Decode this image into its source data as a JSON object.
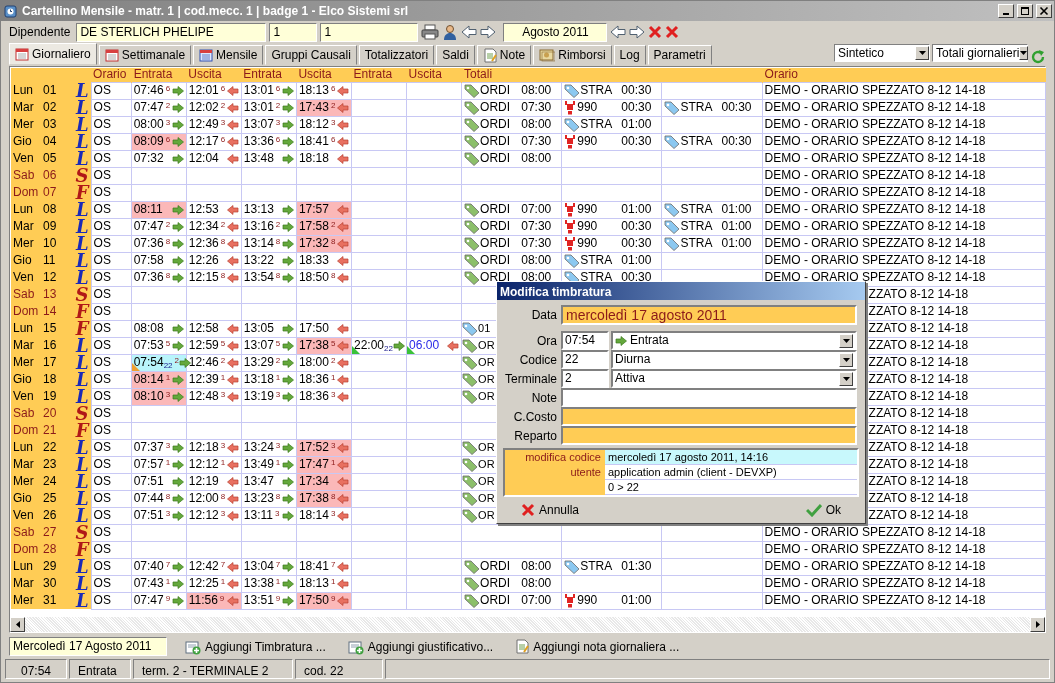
{
  "window": {
    "title": "Cartellino Mensile - matr. 1 | cod.mecc. 1 | badge 1 - Elco Sistemi srl"
  },
  "toolbar": {
    "employee_label": "Dipendente",
    "employee": "DE STERLICH PHELIPE",
    "field_2": "1",
    "field_3": "1",
    "month": "Agosto 2011"
  },
  "tabs": [
    {
      "label": "Giornaliero",
      "selected": true
    },
    {
      "label": "Settimanale",
      "selected": false
    },
    {
      "label": "Mensile",
      "selected": false
    },
    {
      "label": "Gruppi Causali",
      "selected": false
    },
    {
      "label": "Totalizzatori",
      "selected": false
    },
    {
      "label": "Saldi",
      "selected": false
    },
    {
      "label": "Note",
      "selected": false
    },
    {
      "label": "Rimborsi",
      "selected": false
    },
    {
      "label": "Log",
      "selected": false
    },
    {
      "label": "Parametri",
      "selected": false
    }
  ],
  "view_select": "Sintetico",
  "totals_select": "Totali giornalieri",
  "table": {
    "columns": [
      "Orario",
      "Entrata",
      "Uscita",
      "Entrata",
      "Uscita",
      "Entrata",
      "Uscita",
      "Totali",
      "Orario"
    ],
    "days": [
      {
        "day": "Lun",
        "num": "01",
        "letter": "L",
        "rest": false,
        "weekend": false,
        "shift": "OS",
        "punches": [
          {
            "time": "07:46",
            "sup": "6",
            "late": false
          },
          {
            "time": "12:01",
            "sup": "6",
            "late": false
          },
          {
            "time": "13:01",
            "sup": "6",
            "late": false
          },
          {
            "time": "18:13",
            "sup": "6",
            "late": false
          }
        ],
        "totals": [
          {
            "kind": "green",
            "code": "ORDI",
            "time": "08:00"
          },
          {
            "kind": "blue",
            "code": "STRA",
            "time": "00:30"
          }
        ],
        "schedule": "DEMO - ORARIO SPEZZATO 8-12 14-18",
        "behind_dialog": false
      },
      {
        "day": "Mar",
        "num": "02",
        "letter": "L",
        "rest": false,
        "weekend": false,
        "shift": "OS",
        "punches": [
          {
            "time": "07:47",
            "sup": "2",
            "late": false
          },
          {
            "time": "12:02",
            "sup": "2",
            "late": false
          },
          {
            "time": "13:01",
            "sup": "2",
            "late": false
          },
          {
            "time": "17:43",
            "sup": "2",
            "late": true
          }
        ],
        "totals": [
          {
            "kind": "green",
            "code": "ORDI",
            "time": "07:30"
          },
          {
            "kind": "alert",
            "code": "990",
            "time": "00:30"
          },
          {
            "kind": "blue",
            "code": "STRA",
            "time": "00:30"
          }
        ],
        "schedule": "DEMO - ORARIO SPEZZATO 8-12 14-18",
        "behind_dialog": false
      },
      {
        "day": "Mer",
        "num": "03",
        "letter": "L",
        "rest": false,
        "weekend": false,
        "shift": "OS",
        "punches": [
          {
            "time": "08:00",
            "sup": "3",
            "late": false
          },
          {
            "time": "12:49",
            "sup": "3",
            "late": false
          },
          {
            "time": "13:07",
            "sup": "3",
            "late": false
          },
          {
            "time": "18:12",
            "sup": "3",
            "late": false
          }
        ],
        "totals": [
          {
            "kind": "green",
            "code": "ORDI",
            "time": "08:00"
          },
          {
            "kind": "blue",
            "code": "STRA",
            "time": "01:00"
          }
        ],
        "schedule": "DEMO - ORARIO SPEZZATO 8-12 14-18",
        "behind_dialog": false
      },
      {
        "day": "Gio",
        "num": "04",
        "letter": "L",
        "rest": false,
        "weekend": false,
        "shift": "OS",
        "punches": [
          {
            "time": "08:09",
            "sup": "6",
            "late": true
          },
          {
            "time": "12:17",
            "sup": "6",
            "late": false
          },
          {
            "time": "13:36",
            "sup": "6",
            "late": false
          },
          {
            "time": "18:41",
            "sup": "6",
            "late": false
          }
        ],
        "totals": [
          {
            "kind": "green",
            "code": "ORDI",
            "time": "07:30"
          },
          {
            "kind": "alert",
            "code": "990",
            "time": "00:30"
          },
          {
            "kind": "blue",
            "code": "STRA",
            "time": "00:30"
          }
        ],
        "schedule": "DEMO - ORARIO SPEZZATO 8-12 14-18",
        "behind_dialog": false
      },
      {
        "day": "Ven",
        "num": "05",
        "letter": "L",
        "rest": false,
        "weekend": false,
        "shift": "OS",
        "punches": [
          {
            "time": "07:32",
            "late": false
          },
          {
            "time": "12:04",
            "late": false
          },
          {
            "time": "13:48",
            "late": false
          },
          {
            "time": "18:18",
            "late": false
          }
        ],
        "totals": [
          {
            "kind": "green",
            "code": "ORDI",
            "time": "08:00"
          }
        ],
        "schedule": "DEMO - ORARIO SPEZZATO 8-12 14-18",
        "behind_dialog": false
      },
      {
        "day": "Sab",
        "num": "06",
        "letter": "S",
        "rest": true,
        "weekend": true,
        "shift": "OS",
        "schedule": "DEMO - ORARIO SPEZZATO 8-12 14-18",
        "behind_dialog": false
      },
      {
        "day": "Dom",
        "num": "07",
        "letter": "F",
        "rest": true,
        "weekend": true,
        "shift": "OS",
        "schedule": "DEMO - ORARIO SPEZZATO 8-12 14-18",
        "behind_dialog": false
      },
      {
        "day": "Lun",
        "num": "08",
        "letter": "L",
        "rest": false,
        "weekend": false,
        "shift": "OS",
        "punches": [
          {
            "time": "08:11",
            "late": true
          },
          {
            "time": "12:53",
            "late": false
          },
          {
            "time": "13:13",
            "late": false
          },
          {
            "time": "17:57",
            "late": true
          }
        ],
        "totals": [
          {
            "kind": "green",
            "code": "ORDI",
            "time": "07:00"
          },
          {
            "kind": "alert",
            "code": "990",
            "time": "01:00"
          },
          {
            "kind": "blue",
            "code": "STRA",
            "time": "01:00"
          }
        ],
        "schedule": "DEMO - ORARIO SPEZZATO 8-12 14-18",
        "behind_dialog": false
      },
      {
        "day": "Mar",
        "num": "09",
        "letter": "L",
        "rest": false,
        "weekend": false,
        "shift": "OS",
        "punches": [
          {
            "time": "07:47",
            "sup": "2",
            "late": false
          },
          {
            "time": "12:34",
            "sup": "2",
            "late": false
          },
          {
            "time": "13:16",
            "sup": "2",
            "late": false
          },
          {
            "time": "17:58",
            "sup": "2",
            "late": true
          }
        ],
        "totals": [
          {
            "kind": "green",
            "code": "ORDI",
            "time": "07:30"
          },
          {
            "kind": "alert",
            "code": "990",
            "time": "00:30"
          },
          {
            "kind": "blue",
            "code": "STRA",
            "time": "01:00"
          }
        ],
        "schedule": "DEMO - ORARIO SPEZZATO 8-12 14-18",
        "behind_dialog": false
      },
      {
        "day": "Mer",
        "num": "10",
        "letter": "L",
        "rest": false,
        "weekend": false,
        "shift": "OS",
        "punches": [
          {
            "time": "07:36",
            "sup": "8",
            "late": false
          },
          {
            "time": "12:36",
            "sup": "8",
            "late": false
          },
          {
            "time": "13:14",
            "sup": "8",
            "late": false
          },
          {
            "time": "17:32",
            "sup": "8",
            "late": true
          }
        ],
        "totals": [
          {
            "kind": "green",
            "code": "ORDI",
            "time": "07:30"
          },
          {
            "kind": "alert",
            "code": "990",
            "time": "00:30"
          },
          {
            "kind": "blue",
            "code": "STRA",
            "time": "01:00"
          }
        ],
        "schedule": "DEMO - ORARIO SPEZZATO 8-12 14-18",
        "behind_dialog": false
      },
      {
        "day": "Gio",
        "num": "11",
        "letter": "L",
        "rest": false,
        "weekend": false,
        "shift": "OS",
        "punches": [
          {
            "time": "07:58",
            "late": false
          },
          {
            "time": "12:26",
            "late": false
          },
          {
            "time": "13:22",
            "late": false
          },
          {
            "time": "18:33",
            "late": false
          }
        ],
        "totals": [
          {
            "kind": "green",
            "code": "ORDI",
            "time": "08:00"
          },
          {
            "kind": "blue",
            "code": "STRA",
            "time": "01:00"
          }
        ],
        "schedule": "DEMO - ORARIO SPEZZATO 8-12 14-18",
        "behind_dialog": false
      },
      {
        "day": "Ven",
        "num": "12",
        "letter": "L",
        "rest": false,
        "weekend": false,
        "shift": "OS",
        "punches": [
          {
            "time": "07:36",
            "sup": "8",
            "late": false
          },
          {
            "time": "12:15",
            "sup": "8",
            "late": false
          },
          {
            "time": "13:54",
            "sup": "8",
            "late": false
          },
          {
            "time": "18:50",
            "sup": "8",
            "late": false
          }
        ],
        "totals": [
          {
            "kind": "green",
            "code": "ORDI",
            "time": "08:00"
          },
          {
            "kind": "blue",
            "code": "STRA",
            "time": "00:30"
          }
        ],
        "schedule": "DEMO - ORARIO SPEZZATO 8-12 14-18",
        "behind_dialog": false
      },
      {
        "day": "Sab",
        "num": "13",
        "letter": "S",
        "rest": true,
        "weekend": true,
        "shift": "OS",
        "schedule": "ZZATO 8-12 14-18",
        "behind_dialog": true
      },
      {
        "day": "Dom",
        "num": "14",
        "letter": "F",
        "rest": true,
        "weekend": true,
        "shift": "OS",
        "schedule": "ZZATO 8-12 14-18",
        "behind_dialog": true
      },
      {
        "day": "Lun",
        "num": "15",
        "letter": "F",
        "rest": true,
        "weekend": false,
        "shift": "OS",
        "punches": [
          {
            "time": "08:08",
            "late": false
          },
          {
            "time": "12:58",
            "late": false
          },
          {
            "time": "13:05",
            "late": false
          },
          {
            "time": "17:50",
            "late": false
          }
        ],
        "totals": [
          {
            "kind": "blue",
            "code": "01"
          }
        ],
        "schedule": "ZZATO 8-12 14-18",
        "behind_dialog": true
      },
      {
        "day": "Mar",
        "num": "16",
        "letter": "L",
        "rest": false,
        "weekend": false,
        "shift": "OS",
        "punches": [
          {
            "time": "07:53",
            "sup": "5",
            "late": false
          },
          {
            "time": "12:59",
            "sup": "5",
            "late": false
          },
          {
            "time": "13:07",
            "sup": "5",
            "late": false
          },
          {
            "time": "17:38",
            "sup": "5",
            "late": true
          },
          {
            "time": "22:00",
            "sub": "22",
            "late": false,
            "added": true
          },
          {
            "time": "06:00",
            "late": false,
            "added": true,
            "manual": true
          }
        ],
        "totals": [
          {
            "kind": "green",
            "code": "OR"
          }
        ],
        "schedule": "ZZATO 8-12 14-18",
        "behind_dialog": true
      },
      {
        "day": "Mer",
        "num": "17",
        "letter": "L",
        "rest": false,
        "weekend": false,
        "shift": "OS",
        "punches": [
          {
            "time": "07:54",
            "sup": "2",
            "sub": "22",
            "late": false,
            "edited": true
          },
          {
            "time": "12:46",
            "sup": "2",
            "late": false
          },
          {
            "time": "13:29",
            "sup": "2",
            "late": false
          },
          {
            "time": "18:00",
            "sup": "2",
            "late": false
          }
        ],
        "totals": [
          {
            "kind": "green",
            "code": "OR"
          }
        ],
        "schedule": "ZZATO 8-12 14-18",
        "behind_dialog": true
      },
      {
        "day": "Gio",
        "num": "18",
        "letter": "L",
        "rest": false,
        "weekend": false,
        "shift": "OS",
        "punches": [
          {
            "time": "08:14",
            "sup": "1",
            "late": true
          },
          {
            "time": "12:39",
            "sup": "1",
            "late": false
          },
          {
            "time": "13:18",
            "sup": "1",
            "late": false
          },
          {
            "time": "18:36",
            "sup": "1",
            "late": false
          }
        ],
        "totals": [
          {
            "kind": "green",
            "code": "OR"
          }
        ],
        "schedule": "ZZATO 8-12 14-18",
        "behind_dialog": true
      },
      {
        "day": "Ven",
        "num": "19",
        "letter": "L",
        "rest": false,
        "weekend": false,
        "shift": "OS",
        "punches": [
          {
            "time": "08:10",
            "sup": "3",
            "late": true
          },
          {
            "time": "12:48",
            "sup": "3",
            "late": false
          },
          {
            "time": "13:19",
            "sup": "3",
            "late": false
          },
          {
            "time": "18:36",
            "sup": "3",
            "late": false
          }
        ],
        "totals": [
          {
            "kind": "green",
            "code": "OR"
          }
        ],
        "schedule": "ZZATO 8-12 14-18",
        "behind_dialog": true
      },
      {
        "day": "Sab",
        "num": "20",
        "letter": "S",
        "rest": true,
        "weekend": true,
        "shift": "OS",
        "schedule": "ZZATO 8-12 14-18",
        "behind_dialog": true
      },
      {
        "day": "Dom",
        "num": "21",
        "letter": "F",
        "rest": true,
        "weekend": true,
        "shift": "OS",
        "schedule": "ZZATO 8-12 14-18",
        "behind_dialog": true
      },
      {
        "day": "Lun",
        "num": "22",
        "letter": "L",
        "rest": false,
        "weekend": false,
        "shift": "OS",
        "punches": [
          {
            "time": "07:37",
            "sup": "3",
            "late": false
          },
          {
            "time": "12:18",
            "sup": "3",
            "late": false
          },
          {
            "time": "13:24",
            "sup": "3",
            "late": false
          },
          {
            "time": "17:52",
            "sup": "3",
            "late": true
          }
        ],
        "totals": [
          {
            "kind": "green",
            "code": "OR"
          }
        ],
        "schedule": "ZZATO 8-12 14-18",
        "behind_dialog": true
      },
      {
        "day": "Mar",
        "num": "23",
        "letter": "L",
        "rest": false,
        "weekend": false,
        "shift": "OS",
        "punches": [
          {
            "time": "07:57",
            "sup": "1",
            "late": false
          },
          {
            "time": "12:12",
            "sup": "1",
            "late": false
          },
          {
            "time": "13:49",
            "sup": "1",
            "late": false
          },
          {
            "time": "17:47",
            "sup": "1",
            "late": true
          }
        ],
        "totals": [
          {
            "kind": "green",
            "code": "OR"
          }
        ],
        "schedule": "ZZATO 8-12 14-18",
        "behind_dialog": true
      },
      {
        "day": "Mer",
        "num": "24",
        "letter": "L",
        "rest": false,
        "weekend": false,
        "shift": "OS",
        "punches": [
          {
            "time": "07:51",
            "late": false
          },
          {
            "time": "12:19",
            "late": false
          },
          {
            "time": "13:47",
            "late": false
          },
          {
            "time": "17:34",
            "late": true
          }
        ],
        "totals": [
          {
            "kind": "green",
            "code": "OR"
          }
        ],
        "schedule": "ZZATO 8-12 14-18",
        "behind_dialog": true
      },
      {
        "day": "Gio",
        "num": "25",
        "letter": "L",
        "rest": false,
        "weekend": false,
        "shift": "OS",
        "punches": [
          {
            "time": "07:44",
            "sup": "8",
            "late": false
          },
          {
            "time": "12:00",
            "sup": "8",
            "late": false
          },
          {
            "time": "13:23",
            "sup": "8",
            "late": false
          },
          {
            "time": "17:38",
            "sup": "8",
            "late": true
          }
        ],
        "totals": [
          {
            "kind": "green",
            "code": "OR"
          }
        ],
        "schedule": "ZZATO 8-12 14-18",
        "behind_dialog": true
      },
      {
        "day": "Ven",
        "num": "26",
        "letter": "L",
        "rest": false,
        "weekend": false,
        "shift": "OS",
        "punches": [
          {
            "time": "07:51",
            "sup": "3",
            "late": false
          },
          {
            "time": "12:12",
            "sup": "3",
            "late": false
          },
          {
            "time": "13:11",
            "sup": "3",
            "late": false
          },
          {
            "time": "18:14",
            "sup": "3",
            "late": false
          }
        ],
        "totals": [
          {
            "kind": "green",
            "code": "OR"
          }
        ],
        "schedule": "ZZATO 8-12 14-18",
        "behind_dialog": true
      },
      {
        "day": "Sab",
        "num": "27",
        "letter": "S",
        "rest": true,
        "weekend": true,
        "shift": "OS",
        "schedule": "DEMO - ORARIO SPEZZATO 8-12 14-18",
        "behind_dialog": false
      },
      {
        "day": "Dom",
        "num": "28",
        "letter": "F",
        "rest": true,
        "weekend": true,
        "shift": "OS",
        "schedule": "DEMO - ORARIO SPEZZATO 8-12 14-18",
        "behind_dialog": false
      },
      {
        "day": "Lun",
        "num": "29",
        "letter": "L",
        "rest": false,
        "weekend": false,
        "shift": "OS",
        "punches": [
          {
            "time": "07:40",
            "sup": "7",
            "late": false
          },
          {
            "time": "12:42",
            "sup": "7",
            "late": false
          },
          {
            "time": "13:04",
            "sup": "7",
            "late": false
          },
          {
            "time": "18:41",
            "sup": "7",
            "late": false
          }
        ],
        "totals": [
          {
            "kind": "green",
            "code": "ORDI",
            "time": "08:00"
          },
          {
            "kind": "blue",
            "code": "STRA",
            "time": "01:30"
          }
        ],
        "schedule": "DEMO - ORARIO SPEZZATO 8-12 14-18",
        "behind_dialog": false
      },
      {
        "day": "Mar",
        "num": "30",
        "letter": "L",
        "rest": false,
        "weekend": false,
        "shift": "OS",
        "punches": [
          {
            "time": "07:43",
            "sup": "1",
            "late": false
          },
          {
            "time": "12:25",
            "sup": "1",
            "late": false
          },
          {
            "time": "13:38",
            "sup": "1",
            "late": false
          },
          {
            "time": "18:13",
            "sup": "1",
            "late": false
          }
        ],
        "totals": [
          {
            "kind": "green",
            "code": "ORDI",
            "time": "08:00"
          }
        ],
        "schedule": "DEMO - ORARIO SPEZZATO 8-12 14-18",
        "behind_dialog": false
      },
      {
        "day": "Mer",
        "num": "31",
        "letter": "L",
        "rest": false,
        "weekend": false,
        "shift": "OS",
        "punches": [
          {
            "time": "07:47",
            "sup": "9",
            "late": false
          },
          {
            "time": "11:56",
            "sup": "9",
            "late": true
          },
          {
            "time": "13:51",
            "sup": "9",
            "late": false
          },
          {
            "time": "17:50",
            "sup": "9",
            "late": true
          }
        ],
        "totals": [
          {
            "kind": "green",
            "code": "ORDI",
            "time": "07:00"
          },
          {
            "kind": "alert",
            "code": "990",
            "time": "01:00"
          }
        ],
        "schedule": "DEMO - ORARIO SPEZZATO 8-12 14-18",
        "behind_dialog": false
      }
    ]
  },
  "dialog": {
    "title": "Modifica timbratura",
    "fields": [
      {
        "label": "Data",
        "kind": "banner",
        "value": "mercoledì 17 agosto 2011"
      },
      {
        "label": "Ora",
        "kind": "direction",
        "code": "07:54",
        "value": "Entrata"
      },
      {
        "label": "Codice",
        "kind": "combo",
        "code": "22",
        "value": "Diurna"
      },
      {
        "label": "Terminale",
        "kind": "combo",
        "code": "2",
        "value": "Attiva"
      },
      {
        "label": "Note",
        "kind": "text"
      },
      {
        "label": "C.Costo",
        "kind": "required"
      },
      {
        "label": "Reparto",
        "kind": "required"
      }
    ],
    "log": [
      {
        "label": "modifica codice",
        "value": "mercoledì 17 agosto 2011, 14:16",
        "selected": true
      },
      {
        "label": "utente",
        "value": "application admin (client - DEVXP)",
        "selected": false
      },
      {
        "value": "0 > 22",
        "selected": false
      }
    ],
    "buttons": [
      {
        "kind": "cancel",
        "label": "Annulla"
      },
      {
        "kind": "ok",
        "label": "Ok"
      }
    ]
  },
  "actions": {
    "date": "Mercoledì 17 Agosto 2011",
    "buttons": [
      "Aggiungi Timbratura ...",
      "Aggiungi giustificativo...",
      "Aggiungi nota giornaliera ..."
    ]
  },
  "status_bar": [
    "07:54",
    "Entrata",
    "term. 2 - TERMINALE 2",
    "cod. 22"
  ]
}
